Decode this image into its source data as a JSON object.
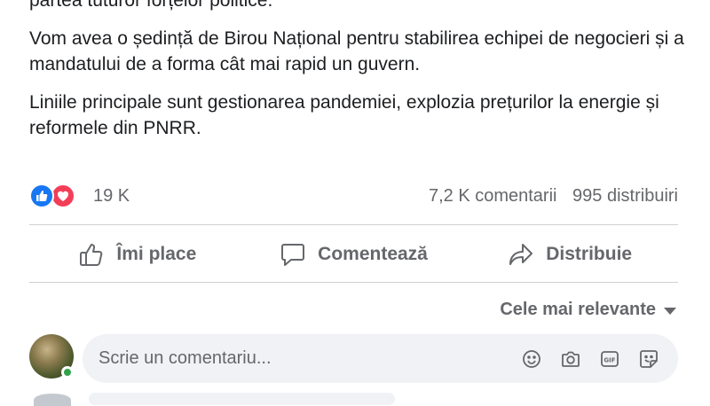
{
  "post": {
    "paragraph_1": "partea tuturor forțelor politice.",
    "paragraph_2": "Vom avea o ședință de Birou Național pentru stabilirea echipei de negocieri și a mandatului de a forma cât mai rapid un guvern.",
    "paragraph_3": "Liniile principale sunt gestionarea pandemiei, explozia prețurilor la energie și reformele din PNRR."
  },
  "stats": {
    "reactions_count": "19 K",
    "comments": "7,2 K comentarii",
    "shares": "995 distribuiri"
  },
  "actions": {
    "like": "Îmi place",
    "comment": "Comentează",
    "share": "Distribuie"
  },
  "sort": {
    "label": "Cele mai relevante"
  },
  "comment_input": {
    "placeholder": "Scrie un comentariu..."
  },
  "icons": {
    "like": "thumbs-up-icon",
    "comment": "speech-bubble-icon",
    "share": "share-arrow-icon",
    "emoji": "smiley-icon",
    "camera": "camera-icon",
    "gif": "gif-icon",
    "sticker": "sticker-icon"
  },
  "colors": {
    "like_blue": "#1877f2",
    "love_red": "#f33e58",
    "secondary_text": "#65676b",
    "online_green": "#31a24c",
    "input_bg": "#f0f2f5"
  }
}
